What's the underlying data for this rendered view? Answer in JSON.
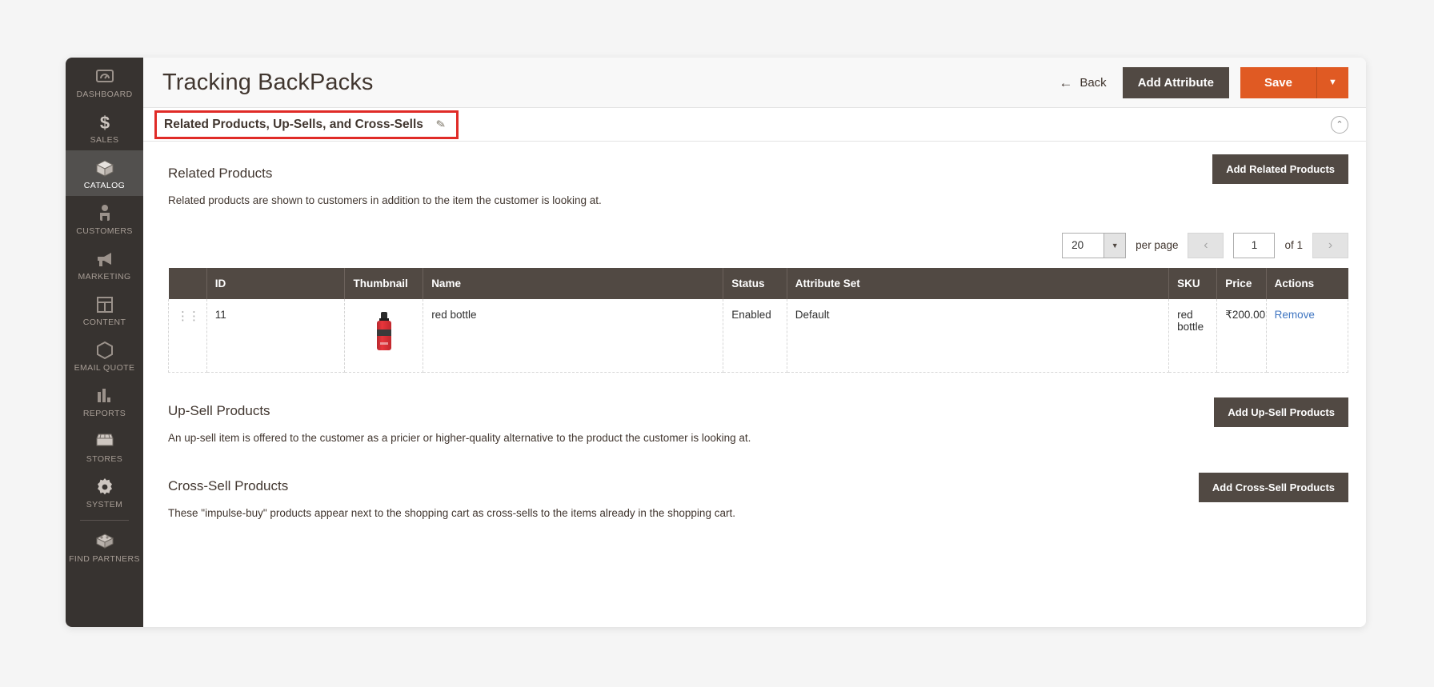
{
  "sidebar": {
    "items": [
      {
        "label": "DASHBOARD",
        "icon": "dashboard-icon",
        "active": false
      },
      {
        "label": "SALES",
        "icon": "dollar-icon",
        "active": false
      },
      {
        "label": "CATALOG",
        "icon": "box-icon",
        "active": true
      },
      {
        "label": "CUSTOMERS",
        "icon": "person-icon",
        "active": false
      },
      {
        "label": "MARKETING",
        "icon": "megaphone-icon",
        "active": false
      },
      {
        "label": "CONTENT",
        "icon": "layout-icon",
        "active": false
      },
      {
        "label": "EMAIL QUOTE",
        "icon": "hexagon-icon",
        "active": false
      },
      {
        "label": "REPORTS",
        "icon": "bar-chart-icon",
        "active": false
      },
      {
        "label": "STORES",
        "icon": "storefront-icon",
        "active": false
      },
      {
        "label": "SYSTEM",
        "icon": "gear-icon",
        "active": false
      },
      {
        "label": "FIND PARTNERS",
        "icon": "extension-icon",
        "active": false
      }
    ]
  },
  "header": {
    "title": "Tracking BackPacks",
    "back_label": "Back",
    "back_arrow": "←",
    "add_attribute_label": "Add Attribute",
    "save_label": "Save",
    "save_dropdown_caret": "▼"
  },
  "section": {
    "title": "Related Products, Up-Sells, and Cross-Sells",
    "edit_icon": "✎",
    "collapse_icon": "⌃",
    "highlight_color": "#e02b27"
  },
  "related": {
    "title": "Related Products",
    "description": "Related products are shown to customers in addition to the item the customer is looking at.",
    "button_label": "Add Related Products"
  },
  "pagination": {
    "per_page_value": "20",
    "per_page_caret": "▼",
    "per_page_label": "per page",
    "prev_arrow": "‹",
    "page_value": "1",
    "of_label": "of 1",
    "next_arrow": "›"
  },
  "table": {
    "columns": [
      "",
      "ID",
      "Thumbnail",
      "Name",
      "Status",
      "Attribute Set",
      "SKU",
      "Price",
      "Actions"
    ],
    "rows": [
      {
        "handle": "⋮⋮",
        "id": "11",
        "thumbnail": "red-bottle-thumbnail",
        "name": "red bottle",
        "status": "Enabled",
        "attribute_set": "Default",
        "sku": "red bottle",
        "price": "₹200.00",
        "action": "Remove"
      }
    ]
  },
  "upsell": {
    "title": "Up-Sell Products",
    "description": "An up-sell item is offered to the customer as a pricier or higher-quality alternative to the product the customer is looking at.",
    "button_label": "Add Up-Sell Products"
  },
  "crosssell": {
    "title": "Cross-Sell Products",
    "description": "These \"impulse-buy\" products appear next to the shopping cart as cross-sells to the items already in the shopping cart.",
    "button_label": "Add Cross-Sell Products"
  },
  "colors": {
    "brand_orange": "#e05a23",
    "brand_dark": "#514943",
    "sidebar_bg": "#373330",
    "link_blue": "#3f75c1"
  }
}
